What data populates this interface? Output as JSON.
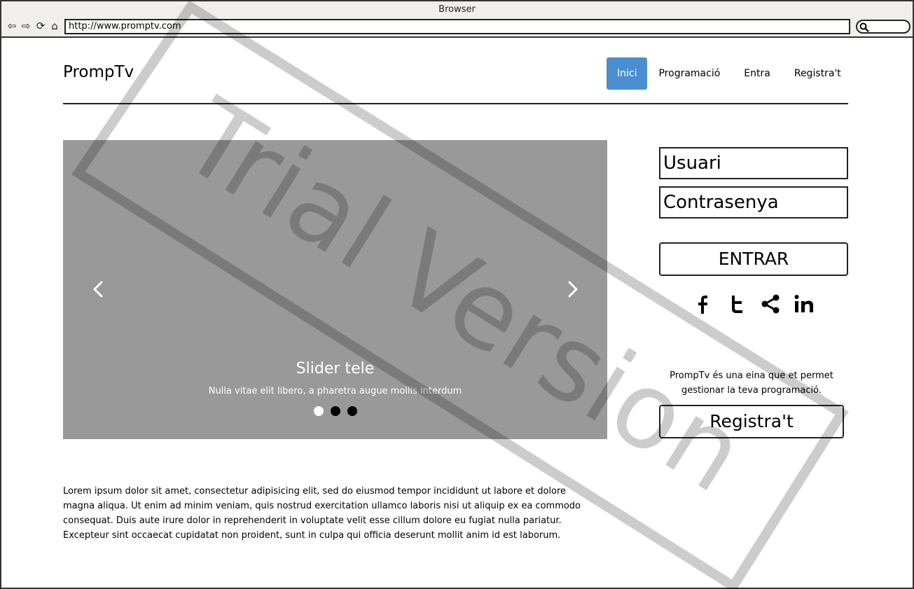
{
  "browser": {
    "title": "Browser",
    "url": "http://www.promptv.com"
  },
  "header": {
    "brand": "PrompTv",
    "nav": [
      {
        "label": "Inici",
        "active": true
      },
      {
        "label": "Programació",
        "active": false
      },
      {
        "label": "Entra",
        "active": false
      },
      {
        "label": "Registra't",
        "active": false
      }
    ]
  },
  "slider": {
    "title": "Slider tele",
    "subtitle": "Nulla vitae elit libero, a pharetra augue mollis interdum",
    "active_slide": 1,
    "slide_count": 3
  },
  "login": {
    "username_placeholder": "Usuari",
    "password_placeholder": "Contrasenya",
    "enter_label": "ENTRAR",
    "socials": [
      "facebook-icon",
      "twitter-icon",
      "share-icon",
      "linkedin-icon"
    ],
    "description": "PrompTv és una eina que et permet gestionar la teva programació.",
    "register_label": "Registra't"
  },
  "content": {
    "lorem": "Lorem ipsum dolor sit amet, consectetur adipisicing elit, sed do eiusmod tempor incididunt ut labore et dolore magna aliqua. Ut enim ad minim veniam, quis nostrud exercitation ullamco laboris nisi ut aliquip ex ea commodo consequat. Duis aute irure dolor in reprehenderit in voluptate velit esse cillum dolore eu fugiat nulla pariatur. Excepteur sint occaecat cupidatat non proident, sunt in culpa qui officia deserunt mollit anim id est laborum."
  },
  "watermark": {
    "text": "Trial Version"
  },
  "colors": {
    "accent": "#4a8ed0",
    "slider_bg": "#999999"
  }
}
